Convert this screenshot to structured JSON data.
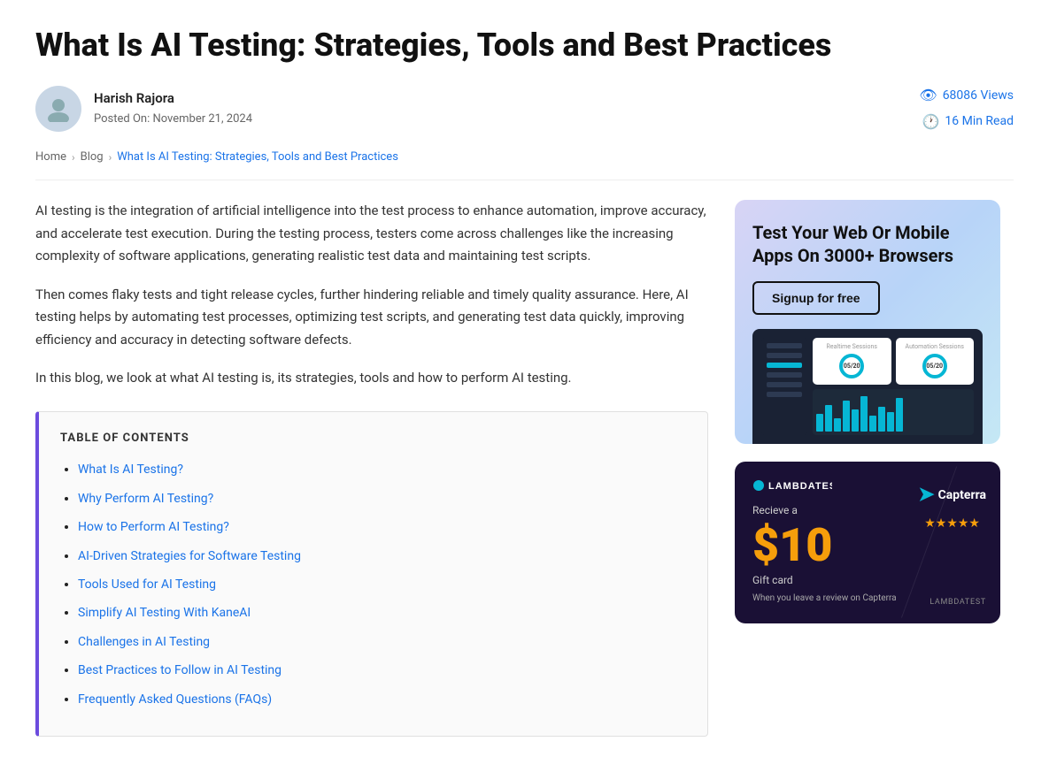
{
  "article": {
    "title": "What Is AI Testing: Strategies, Tools and Best Practices",
    "author": {
      "name": "Harish Rajora",
      "posted_label": "Posted On:",
      "posted_date": "November 21, 2024",
      "avatar_initial": "👤"
    },
    "meta": {
      "views": "68086 Views",
      "read_time": "16 Min Read"
    },
    "breadcrumb": {
      "home": "Home",
      "blog": "Blog",
      "current": "What Is AI Testing: Strategies, Tools and Best Practices"
    },
    "paragraphs": [
      "AI testing is the integration of artificial intelligence into the test process to enhance automation, improve accuracy, and accelerate test execution. During the testing process, testers come across challenges like the increasing complexity of software applications, generating realistic test data and maintaining test scripts.",
      "Then comes flaky tests and tight release cycles, further hindering reliable and timely quality assurance. Here, AI testing helps by automating test processes, optimizing test scripts, and generating test data quickly, improving efficiency and accuracy in detecting software defects.",
      "In this blog, we look at what AI testing is, its strategies, tools and how to perform AI testing."
    ],
    "toc": {
      "title": "TABLE OF CONTENTS",
      "items": [
        "What Is AI Testing?",
        "Why Perform AI Testing?",
        "How to Perform AI Testing?",
        "AI-Driven Strategies for Software Testing",
        "Tools Used for AI Testing",
        "Simplify AI Testing With KaneAI",
        "Challenges in AI Testing",
        "Best Practices to Follow in AI Testing",
        "Frequently Asked Questions (FAQs)"
      ]
    }
  },
  "sidebar": {
    "card1": {
      "title": "Test Your Web Or Mobile Apps On 3000+ Browsers",
      "button_label": "Signup for free"
    },
    "card2": {
      "logo": "LAMBDATEST",
      "subtitle": "Recieve a",
      "amount": "$10",
      "gift_label": "Gift card",
      "gift_sublabel": "When you leave a review on Capterra",
      "capterra_label": "Capterra",
      "stars": "★★★★★",
      "lambdatest_label": "LAMBDATEST"
    }
  },
  "icons": {
    "eye": "👁",
    "clock": "🕐",
    "chevron": "›"
  }
}
